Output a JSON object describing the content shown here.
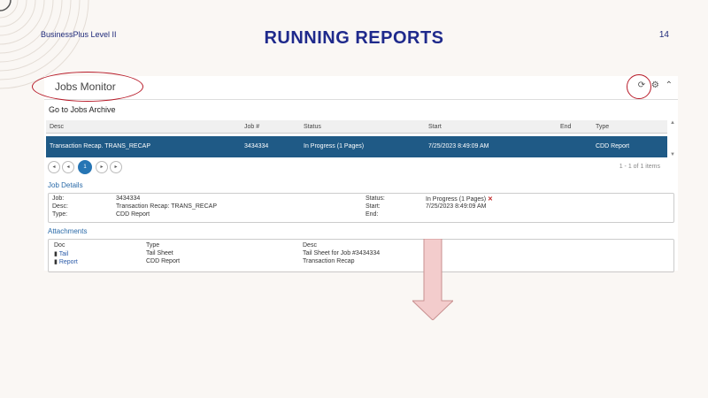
{
  "slide": {
    "header_left": "BusinessPlus Level II",
    "title": "RUNNING  REPORTS",
    "page": "14"
  },
  "panel": {
    "title": "Jobs Monitor",
    "icons": [
      "refresh-icon",
      "gear-icon",
      "chevron-up-icon"
    ],
    "archive_link": "Go to Jobs Archive"
  },
  "table": {
    "headers": {
      "desc": "Desc",
      "job": "Job #",
      "status": "Status",
      "start": "Start",
      "end": "End",
      "type": "Type"
    },
    "row": {
      "desc": "Transaction Recap. TRANS_RECAP",
      "job": "3434334",
      "status": "In Progress (1 Pages)",
      "start": "7/25/2023 8:49:09 AM",
      "end": "",
      "type": "CDD Report"
    },
    "pager": {
      "current": "1",
      "count": "1 - 1 of 1 items"
    }
  },
  "job_details": {
    "label": "Job Details",
    "job_label": "Job:",
    "job_value": "3434334",
    "desc_label": "Desc:",
    "desc_value": "Transaction Recap: TRANS_RECAP",
    "type_label": "Type:",
    "type_value": "CDD Report",
    "status_label": "Status:",
    "status_value": "In Progress (1 Pages)",
    "start_label": "Start:",
    "start_value": "7/25/2023 8:49:09 AM",
    "end_label": "End:",
    "end_value": ""
  },
  "attachments": {
    "label": "Attachments",
    "headers": {
      "doc": "Doc",
      "type": "Type",
      "desc": "Desc"
    },
    "rows": [
      {
        "doc": "Tail",
        "type": "Tail Sheet",
        "desc": "Tail Sheet for Job #3434334"
      },
      {
        "doc": "Report",
        "type": "CDD Report",
        "desc": "Transaction Recap"
      }
    ]
  },
  "colors": {
    "title": "#1f2a8c",
    "selected_row": "#1f5a86",
    "highlight": "#b81c2a",
    "arrow": "#f3cccc"
  }
}
